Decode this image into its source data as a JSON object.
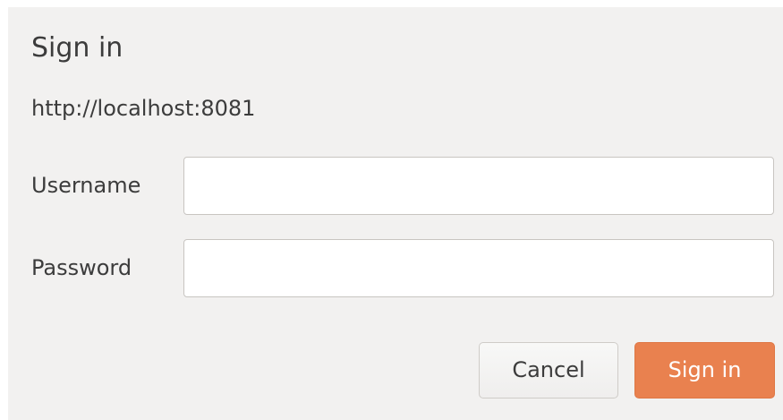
{
  "dialog": {
    "title": "Sign in",
    "url": "http://localhost:8081",
    "username": {
      "label": "Username",
      "value": ""
    },
    "password": {
      "label": "Password",
      "value": ""
    },
    "buttons": {
      "cancel_label": "Cancel",
      "signin_label": "Sign in"
    }
  },
  "colors": {
    "dialog_background": "#f2f1f0",
    "accent": "#e9814f",
    "text": "#3c3c3c"
  }
}
